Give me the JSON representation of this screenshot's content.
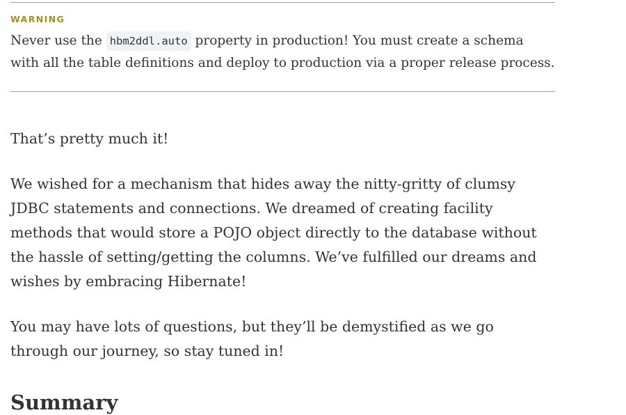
{
  "warning": {
    "label": "WARNING",
    "text_before": "Never use the ",
    "code": "hbm2ddl.auto",
    "text_after": " property in production! You must create a schema with all the table definitions and deploy to production via a proper release process."
  },
  "paragraphs": [
    "That’s pretty much it!",
    "We wished for a mechanism that hides away the nitty-gritty of clumsy JDBC statements and connections. We dreamed of creating facility methods that would store a POJO object directly to the database without the hassle of setting/getting the columns. We’ve fulfilled our dreams and wishes by embracing Hibernate!",
    "You may have lots of questions, but they’ll be demystified as we go through our journey, so stay tuned in!"
  ],
  "next_heading": "Summary"
}
